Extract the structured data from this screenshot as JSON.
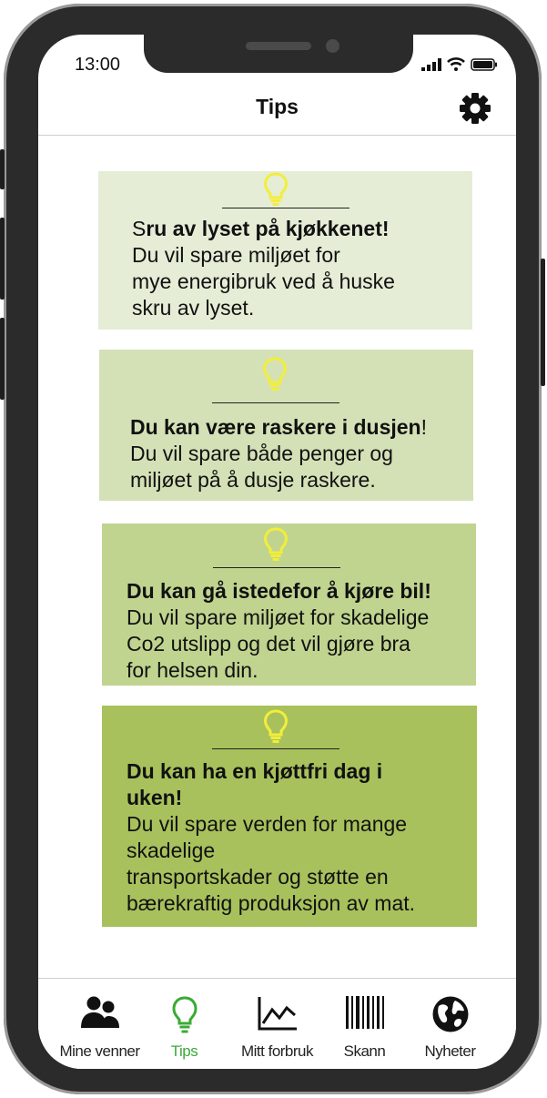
{
  "status_bar": {
    "time": "13:00"
  },
  "header": {
    "title": "Tips",
    "settings_icon": "gear-icon"
  },
  "cards": [
    {
      "title_pre": "S",
      "title_main": "ru av lyset på kjøkkenet!",
      "title_post": "",
      "body": [
        "Du vil spare miljøet for",
        "mye energibruk ved å huske",
        "skru av lyset."
      ],
      "bg": "#e5edd6"
    },
    {
      "title_pre": "",
      "title_main": "Du kan være raskere i dusjen",
      "title_post": "!",
      "body": [
        "Du vil spare både penger og",
        "miljøet på å dusje raskere."
      ],
      "bg": "#d4e1b7"
    },
    {
      "title_pre": "",
      "title_main": "Du kan gå istedefor å kjøre bil!",
      "title_post": "",
      "body": [
        "Du vil spare miljøet for skadelige",
        "Co2 utslipp og det vil gjøre bra",
        "for helsen din."
      ],
      "bg": "#c0d48f"
    },
    {
      "title_pre": "",
      "title_main": "Du kan ha en kjøttfri dag i",
      "title_main2": "uken!",
      "body": [
        "Du vil spare verden for mange",
        "skadelige",
        "transportskader og støtte en",
        "bærekraftig produksjon av mat."
      ],
      "bg": "#a8c15c"
    }
  ],
  "tabs": [
    {
      "label": "Mine venner",
      "icon": "friends-icon"
    },
    {
      "label": "Tips",
      "icon": "lightbulb-icon",
      "active": true
    },
    {
      "label": "Mitt forbruk",
      "icon": "line-chart-icon"
    },
    {
      "label": "Skann",
      "icon": "barcode-icon"
    },
    {
      "label": "Nyheter",
      "icon": "globe-icon"
    }
  ],
  "colors": {
    "accent": "#3aaa35",
    "bulb": "#f2ee3a"
  }
}
